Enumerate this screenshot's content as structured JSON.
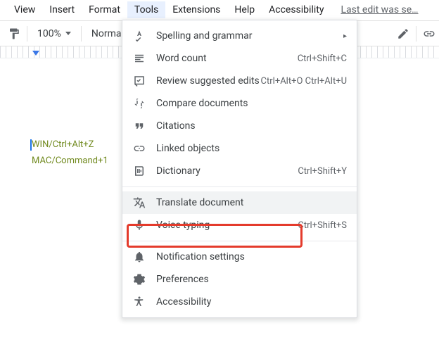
{
  "menubar": {
    "items": [
      "View",
      "Insert",
      "Format",
      "Tools",
      "Extensions",
      "Help",
      "Accessibility"
    ],
    "activeIndex": 3,
    "editLink": "Last edit was se…"
  },
  "toolbar": {
    "zoom": "100%",
    "style": "Normal"
  },
  "doc": {
    "line1": "WIN/Ctrl+Alt+Z",
    "line2": "MAC/Command+1"
  },
  "menu": {
    "items": [
      {
        "icon": "spell",
        "label": "Spelling and grammar",
        "right": "▸",
        "arrow": true
      },
      {
        "icon": "wordcount",
        "label": "Word count",
        "right": "Ctrl+Shift+C"
      },
      {
        "icon": "review",
        "label": "Review suggested edits",
        "right": "Ctrl+Alt+O Ctrl+Alt+U"
      },
      {
        "icon": "compare",
        "label": "Compare documents",
        "right": ""
      },
      {
        "icon": "cite",
        "label": "Citations",
        "right": ""
      },
      {
        "icon": "linked",
        "label": "Linked objects",
        "right": ""
      },
      {
        "icon": "dict",
        "label": "Dictionary",
        "right": "Ctrl+Shift+Y"
      },
      {
        "divider": true
      },
      {
        "icon": "translate",
        "label": "Translate document",
        "right": "",
        "hovered": true
      },
      {
        "icon": "voice",
        "label": "Voice typing",
        "right": "Ctrl+Shift+S"
      },
      {
        "divider": true
      },
      {
        "icon": "bell",
        "label": "Notification settings",
        "right": ""
      },
      {
        "icon": "prefs",
        "label": "Preferences",
        "right": ""
      },
      {
        "icon": "a11y",
        "label": "Accessibility",
        "right": ""
      }
    ]
  }
}
